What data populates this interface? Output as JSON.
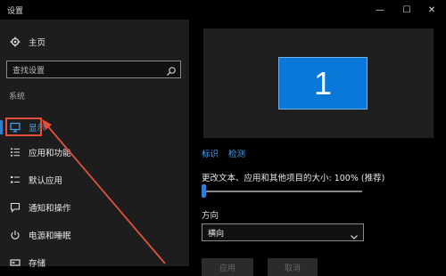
{
  "window": {
    "title": "设置",
    "minimize": "—",
    "maximize": "☐",
    "close": "✕"
  },
  "sidebar": {
    "home_label": "主页",
    "search_placeholder": "查找设置",
    "section": "系统",
    "items": [
      {
        "label": "显示",
        "icon": "monitor-icon",
        "active": true
      },
      {
        "label": "应用和功能",
        "icon": "list-icon"
      },
      {
        "label": "默认应用",
        "icon": "default-apps-icon"
      },
      {
        "label": "通知和操作",
        "icon": "message-icon"
      },
      {
        "label": "电源和睡眠",
        "icon": "power-icon"
      },
      {
        "label": "存储",
        "icon": "storage-icon"
      }
    ]
  },
  "content": {
    "monitor_number": "1",
    "link_identify": "标识",
    "link_detect": "检测",
    "scale_label": "更改文本、应用和其他项目的大小: 100% (推荐)",
    "scale_percent": 0,
    "orientation_label": "方向",
    "orientation_value": "横向",
    "apply_button": "应用",
    "cancel_button": "取消"
  },
  "colors": {
    "accent": "#2f7fd1",
    "annotation": "#e2503c",
    "monitor": "#0a78d8"
  }
}
